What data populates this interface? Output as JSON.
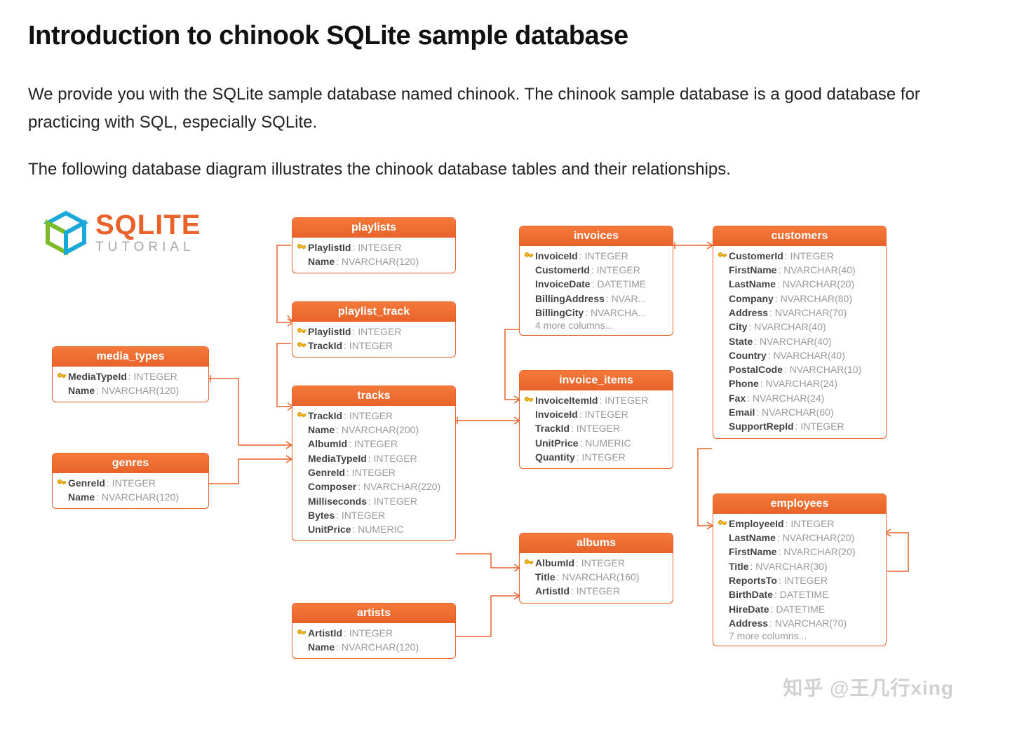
{
  "title": "Introduction to chinook SQLite sample database",
  "paragraphs": [
    "We provide you with the SQLite sample database named chinook. The chinook sample database is a good database for practicing with SQL, especially SQLite.",
    "The following database diagram illustrates the chinook database tables and their relationships."
  ],
  "logo": {
    "line1": "SQLITE",
    "line2": "TUTORIAL"
  },
  "entities": {
    "media_types": {
      "title": "media_types",
      "fields": [
        {
          "key": true,
          "name": "MediaTypeId",
          "type": "INTEGER"
        },
        {
          "key": false,
          "name": "Name",
          "type": "NVARCHAR(120)"
        }
      ]
    },
    "genres": {
      "title": "genres",
      "fields": [
        {
          "key": true,
          "name": "GenreId",
          "type": "INTEGER"
        },
        {
          "key": false,
          "name": "Name",
          "type": "NVARCHAR(120)"
        }
      ]
    },
    "playlists": {
      "title": "playlists",
      "fields": [
        {
          "key": true,
          "name": "PlaylistId",
          "type": "INTEGER"
        },
        {
          "key": false,
          "name": "Name",
          "type": "NVARCHAR(120)"
        }
      ]
    },
    "playlist_track": {
      "title": "playlist_track",
      "fields": [
        {
          "key": true,
          "name": "PlaylistId",
          "type": "INTEGER"
        },
        {
          "key": true,
          "name": "TrackId",
          "type": "INTEGER"
        }
      ]
    },
    "tracks": {
      "title": "tracks",
      "fields": [
        {
          "key": true,
          "name": "TrackId",
          "type": "INTEGER"
        },
        {
          "key": false,
          "name": "Name",
          "type": "NVARCHAR(200)"
        },
        {
          "key": false,
          "name": "AlbumId",
          "type": "INTEGER"
        },
        {
          "key": false,
          "name": "MediaTypeId",
          "type": "INTEGER"
        },
        {
          "key": false,
          "name": "GenreId",
          "type": "INTEGER"
        },
        {
          "key": false,
          "name": "Composer",
          "type": "NVARCHAR(220)"
        },
        {
          "key": false,
          "name": "Milliseconds",
          "type": "INTEGER"
        },
        {
          "key": false,
          "name": "Bytes",
          "type": "INTEGER"
        },
        {
          "key": false,
          "name": "UnitPrice",
          "type": "NUMERIC"
        }
      ]
    },
    "artists": {
      "title": "artists",
      "fields": [
        {
          "key": true,
          "name": "ArtistId",
          "type": "INTEGER"
        },
        {
          "key": false,
          "name": "Name",
          "type": "NVARCHAR(120)"
        }
      ]
    },
    "invoices": {
      "title": "invoices",
      "fields": [
        {
          "key": true,
          "name": "InvoiceId",
          "type": "INTEGER"
        },
        {
          "key": false,
          "name": "CustomerId",
          "type": "INTEGER"
        },
        {
          "key": false,
          "name": "InvoiceDate",
          "type": "DATETIME"
        },
        {
          "key": false,
          "name": "BillingAddress",
          "type": "NVAR..."
        },
        {
          "key": false,
          "name": "BillingCity",
          "type": "NVARCHA..."
        }
      ],
      "more": "4 more columns..."
    },
    "invoice_items": {
      "title": "invoice_items",
      "fields": [
        {
          "key": true,
          "name": "InvoiceItemId",
          "type": "INTEGER"
        },
        {
          "key": false,
          "name": "InvoiceId",
          "type": "INTEGER"
        },
        {
          "key": false,
          "name": "TrackId",
          "type": "INTEGER"
        },
        {
          "key": false,
          "name": "UnitPrice",
          "type": "NUMERIC"
        },
        {
          "key": false,
          "name": "Quantity",
          "type": "INTEGER"
        }
      ]
    },
    "albums": {
      "title": "albums",
      "fields": [
        {
          "key": true,
          "name": "AlbumId",
          "type": "INTEGER"
        },
        {
          "key": false,
          "name": "Title",
          "type": "NVARCHAR(160)"
        },
        {
          "key": false,
          "name": "ArtistId",
          "type": "INTEGER"
        }
      ]
    },
    "customers": {
      "title": "customers",
      "fields": [
        {
          "key": true,
          "name": "CustomerId",
          "type": "INTEGER"
        },
        {
          "key": false,
          "name": "FirstName",
          "type": "NVARCHAR(40)"
        },
        {
          "key": false,
          "name": "LastName",
          "type": "NVARCHAR(20)"
        },
        {
          "key": false,
          "name": "Company",
          "type": "NVARCHAR(80)"
        },
        {
          "key": false,
          "name": "Address",
          "type": "NVARCHAR(70)"
        },
        {
          "key": false,
          "name": "City",
          "type": "NVARCHAR(40)"
        },
        {
          "key": false,
          "name": "State",
          "type": "NVARCHAR(40)"
        },
        {
          "key": false,
          "name": "Country",
          "type": "NVARCHAR(40)"
        },
        {
          "key": false,
          "name": "PostalCode",
          "type": "NVARCHAR(10)"
        },
        {
          "key": false,
          "name": "Phone",
          "type": "NVARCHAR(24)"
        },
        {
          "key": false,
          "name": "Fax",
          "type": "NVARCHAR(24)"
        },
        {
          "key": false,
          "name": "Email",
          "type": "NVARCHAR(60)"
        },
        {
          "key": false,
          "name": "SupportRepId",
          "type": "INTEGER"
        }
      ]
    },
    "employees": {
      "title": "employees",
      "fields": [
        {
          "key": true,
          "name": "EmployeeId",
          "type": "INTEGER"
        },
        {
          "key": false,
          "name": "LastName",
          "type": "NVARCHAR(20)"
        },
        {
          "key": false,
          "name": "FirstName",
          "type": "NVARCHAR(20)"
        },
        {
          "key": false,
          "name": "Title",
          "type": "NVARCHAR(30)"
        },
        {
          "key": false,
          "name": "ReportsTo",
          "type": "INTEGER"
        },
        {
          "key": false,
          "name": "BirthDate",
          "type": "DATETIME"
        },
        {
          "key": false,
          "name": "HireDate",
          "type": "DATETIME"
        },
        {
          "key": false,
          "name": "Address",
          "type": "NVARCHAR(70)"
        }
      ],
      "more": "7 more columns..."
    }
  },
  "watermark": "知乎 @王几行xing"
}
